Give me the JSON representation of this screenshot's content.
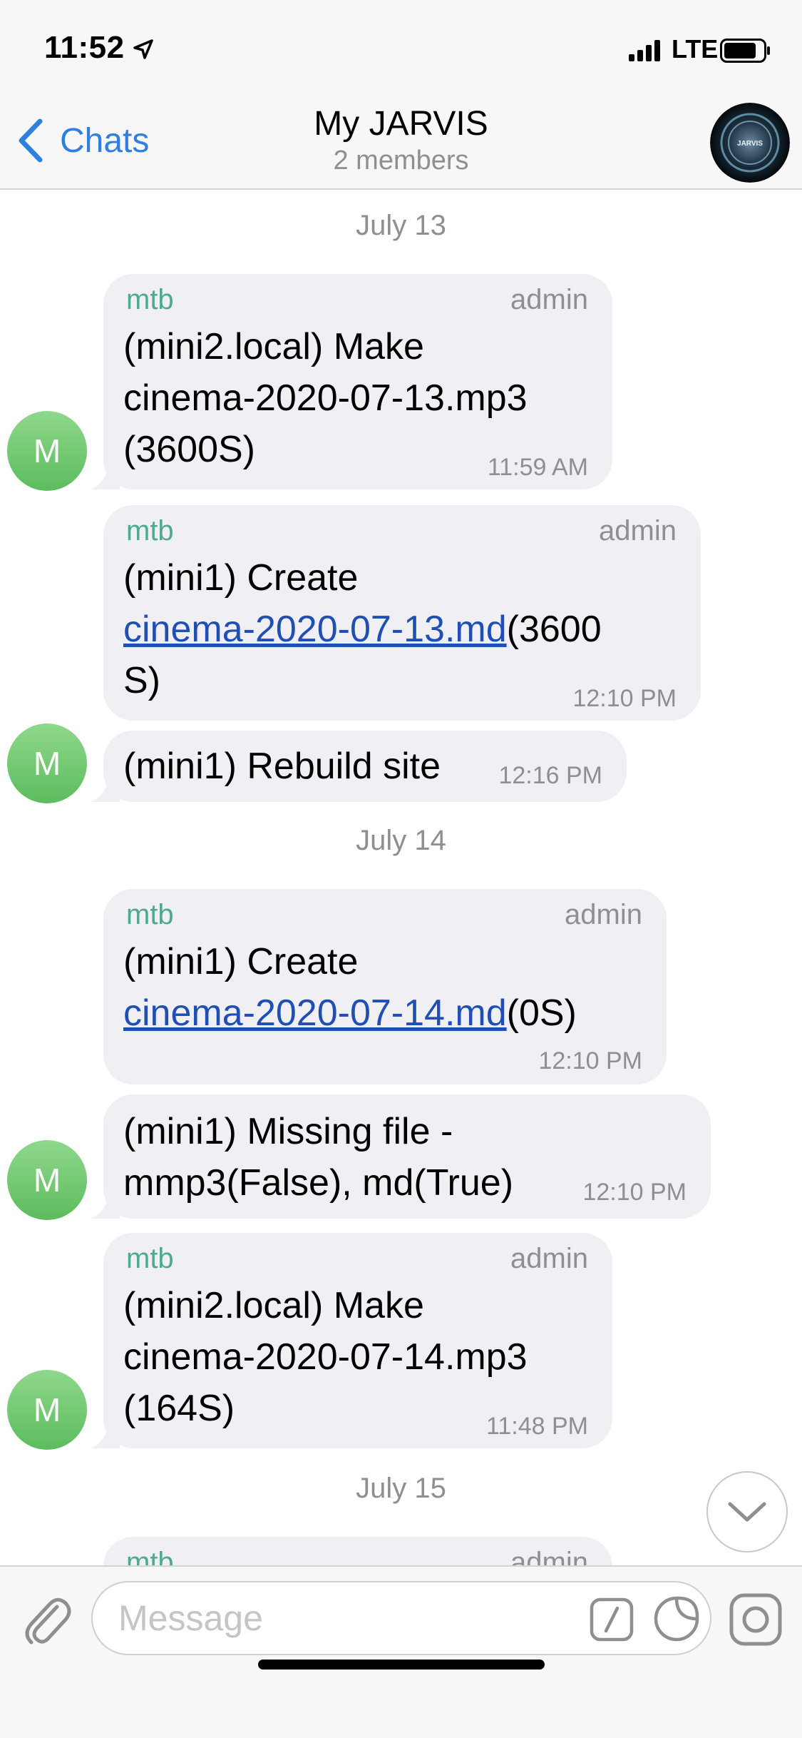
{
  "status_bar": {
    "time": "11:52",
    "carrier": "LTE"
  },
  "nav": {
    "back_label": "Chats",
    "title": "My JARVIS",
    "subtitle": "2 members",
    "avatar_text": "JARVIS"
  },
  "messages": [
    {
      "date": "July 13"
    },
    {
      "sender": "mtb",
      "role": "admin",
      "line1": "(mini2.local) Make",
      "line2": "cinema-2020-07-13.mp3",
      "line3": "(3600S)",
      "time": "11:59 AM",
      "avatar": "M"
    },
    {
      "sender": "mtb",
      "role": "admin",
      "line1": "(mini1) Create",
      "link": "cinema-2020-07-13.md",
      "after_link": "(3600",
      "line3": "S)",
      "time": "12:10 PM"
    },
    {
      "text": "(mini1) Rebuild site",
      "time": "12:16 PM",
      "avatar": "M"
    },
    {
      "date": "July 14"
    },
    {
      "sender": "mtb",
      "role": "admin",
      "line1": "(mini1) Create",
      "link": "cinema-2020-07-14.md",
      "after_link": "(0S)",
      "time": "12:10 PM"
    },
    {
      "line1": "(mini1) Missing file -",
      "line2": "mmp3(False), md(True)",
      "time": "12:10 PM",
      "avatar": "M"
    },
    {
      "sender": "mtb",
      "role": "admin",
      "line1": "(mini2.local) Make",
      "line2": "cinema-2020-07-14.mp3",
      "line3": "(164S)",
      "time": "11:48 PM",
      "avatar": "M"
    },
    {
      "date": "July 15"
    },
    {
      "sender": "mtb",
      "role": "admin"
    }
  ],
  "input": {
    "placeholder": "Message"
  },
  "colors": {
    "accent": "#2f7fe0",
    "sender": "#4fa98f",
    "bubble": "#efeff4",
    "link": "#1f4fb4",
    "avatar": "#6cc56c"
  }
}
